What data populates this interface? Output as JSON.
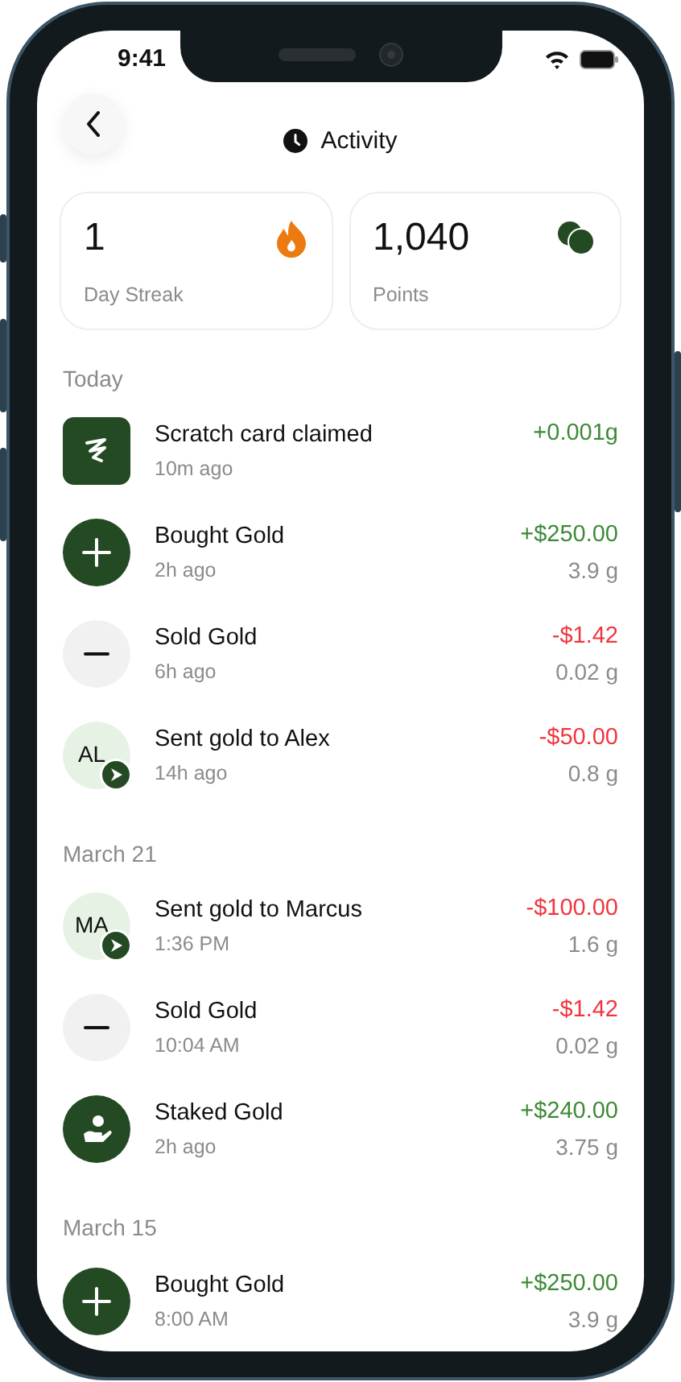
{
  "status_bar": {
    "time": "9:41"
  },
  "header": {
    "title": "Activity"
  },
  "stats": [
    {
      "value": "1",
      "label": "Day Streak",
      "kind": "streak"
    },
    {
      "value": "1,040",
      "label": "Points",
      "kind": "points"
    }
  ],
  "sections": [
    {
      "title": "Today",
      "items": [
        {
          "kind": "scratch",
          "title": "Scratch card claimed",
          "time": "10m ago",
          "amount": "+0.001g",
          "color": "#3d8a36"
        },
        {
          "kind": "buy",
          "title": "Bought Gold",
          "time": "2h ago",
          "amount": "+$250.00",
          "color": "#3d8a36",
          "weight": "3.9 g"
        },
        {
          "kind": "sell",
          "title": "Sold Gold",
          "time": "6h ago",
          "amount": "-$1.42",
          "color": "#f0353d",
          "weight": "0.02 g"
        },
        {
          "kind": "send",
          "initials": "AL",
          "title": "Sent gold to Alex",
          "time": "14h ago",
          "amount": "-$50.00",
          "color": "#f0353d",
          "weight": "0.8 g"
        }
      ]
    },
    {
      "title": "March 21",
      "items": [
        {
          "kind": "send",
          "initials": "MA",
          "title": "Sent gold to Marcus",
          "time": "1:36 PM",
          "amount": "-$100.00",
          "color": "#f0353d",
          "weight": "1.6 g"
        },
        {
          "kind": "sell",
          "title": "Sold Gold",
          "time": "10:04 AM",
          "amount": "-$1.42",
          "color": "#f0353d",
          "weight": "0.02 g"
        },
        {
          "kind": "stake",
          "title": "Staked Gold",
          "time": "2h ago",
          "amount": "+$240.00",
          "color": "#3d8a36",
          "weight": "3.75 g"
        }
      ]
    },
    {
      "title": "March 15",
      "items": [
        {
          "kind": "buy",
          "title": "Bought Gold",
          "time": "8:00 AM",
          "amount": "+$250.00",
          "color": "#3d8a36",
          "weight": "3.9 g"
        }
      ]
    }
  ]
}
